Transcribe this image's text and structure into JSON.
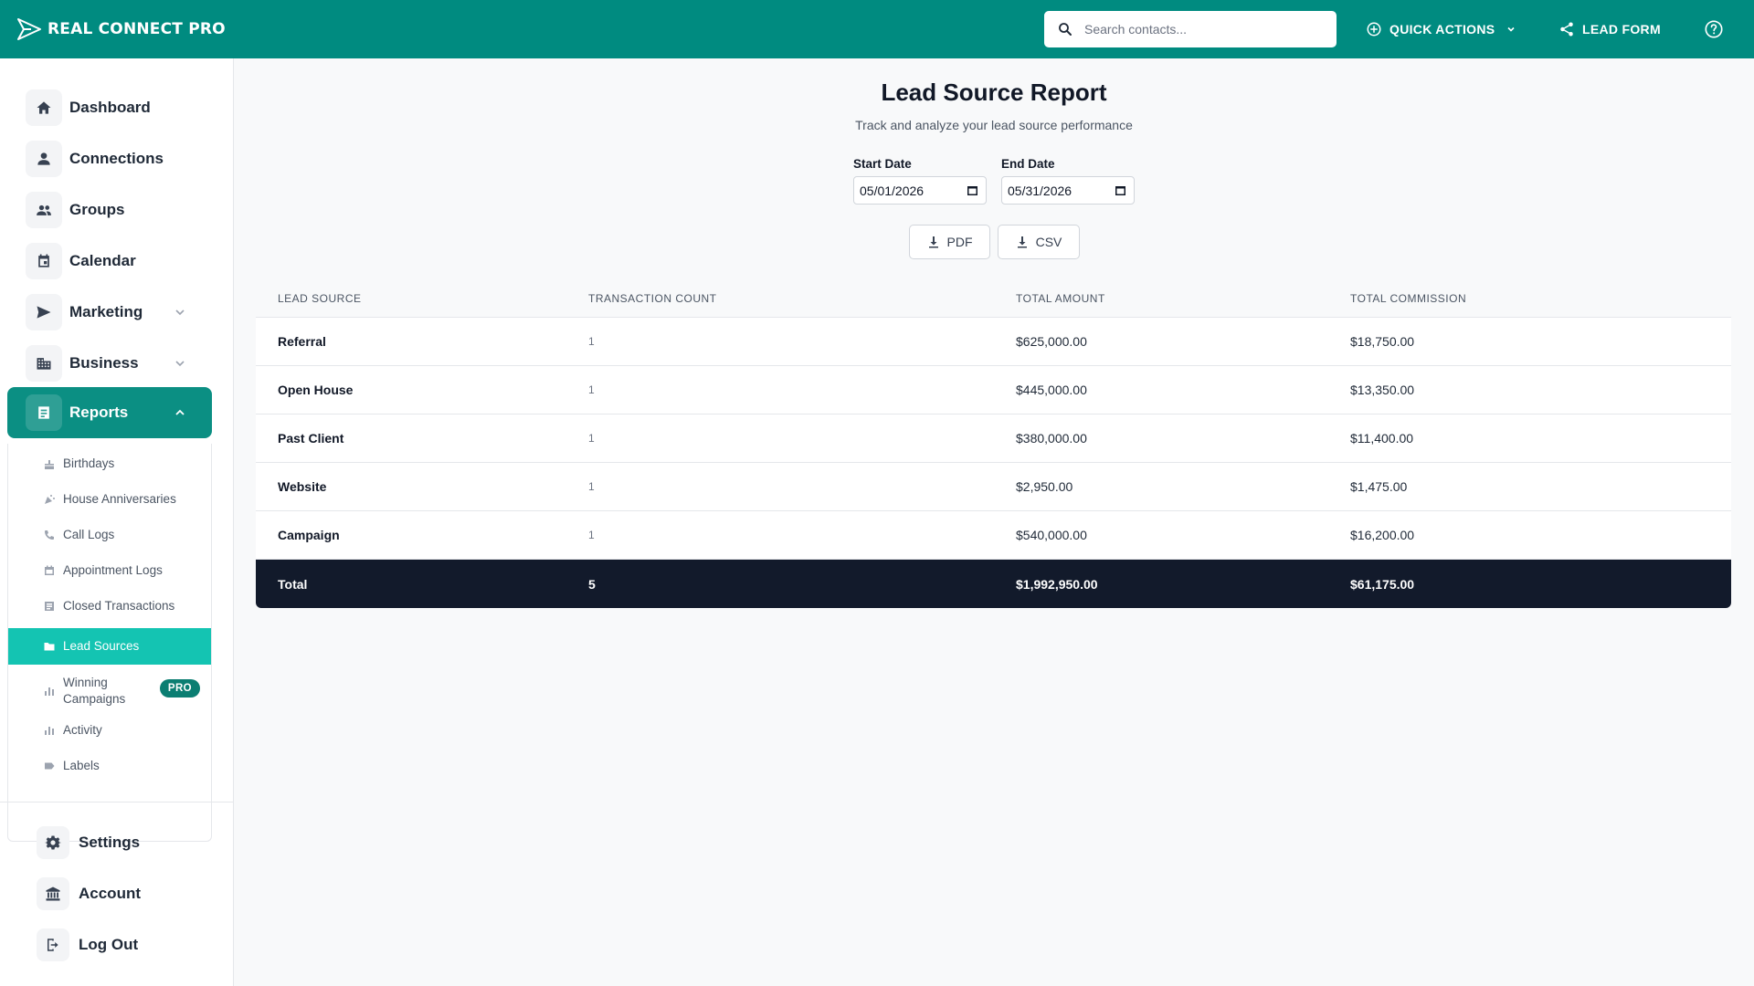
{
  "app": {
    "brand_name": "REAL CONNECT PRO",
    "accent": "#008b80"
  },
  "topbar": {
    "search_placeholder": "Search contacts...",
    "quick_actions_label": "QUICK ACTIONS",
    "lead_form_label": "LEAD FORM"
  },
  "sidebar": {
    "items": [
      {
        "label": "Dashboard",
        "icon": "home-icon"
      },
      {
        "label": "Connections",
        "icon": "person-icon"
      },
      {
        "label": "Groups",
        "icon": "people-icon"
      },
      {
        "label": "Calendar",
        "icon": "calendar-icon"
      },
      {
        "label": "Marketing",
        "icon": "send-icon"
      },
      {
        "label": "Business",
        "icon": "building-icon"
      },
      {
        "label": "Reports",
        "icon": "report-icon"
      }
    ],
    "reports_sub": [
      {
        "label": "Birthdays"
      },
      {
        "label": "House Anniversaries"
      },
      {
        "label": "Call Logs"
      },
      {
        "label": "Appointment Logs"
      },
      {
        "label": "Closed Transactions"
      },
      {
        "label": "Lead Sources"
      },
      {
        "label": "Winning Campaigns",
        "badge": "PRO"
      },
      {
        "label": "Activity"
      },
      {
        "label": "Labels"
      }
    ],
    "footer": [
      {
        "label": "Settings",
        "icon": "gear-icon"
      },
      {
        "label": "Account",
        "icon": "bank-icon"
      },
      {
        "label": "Log Out",
        "icon": "logout-icon"
      }
    ]
  },
  "report": {
    "title": "Lead Source Report",
    "subtitle": "Track and analyze your lead source performance",
    "start_date_label": "Start Date",
    "start_date": "05/01/2026",
    "end_date_label": "End Date",
    "end_date": "05/31/2026",
    "pdf_label": "PDF",
    "csv_label": "CSV"
  },
  "table": {
    "headers": [
      "LEAD SOURCE",
      "TRANSACTION COUNT",
      "TOTAL AMOUNT",
      "TOTAL COMMISSION"
    ],
    "rows": [
      {
        "source": "Referral",
        "count": "1",
        "amount": "$625,000.00",
        "commission": "$18,750.00"
      },
      {
        "source": "Open House",
        "count": "1",
        "amount": "$445,000.00",
        "commission": "$13,350.00"
      },
      {
        "source": "Past Client",
        "count": "1",
        "amount": "$380,000.00",
        "commission": "$11,400.00"
      },
      {
        "source": "Website",
        "count": "1",
        "amount": "$2,950.00",
        "commission": "$1,475.00"
      },
      {
        "source": "Campaign",
        "count": "1",
        "amount": "$540,000.00",
        "commission": "$16,200.00"
      }
    ],
    "total": {
      "label": "Total",
      "count": "5",
      "amount": "$1,992,950.00",
      "commission": "$61,175.00"
    }
  }
}
